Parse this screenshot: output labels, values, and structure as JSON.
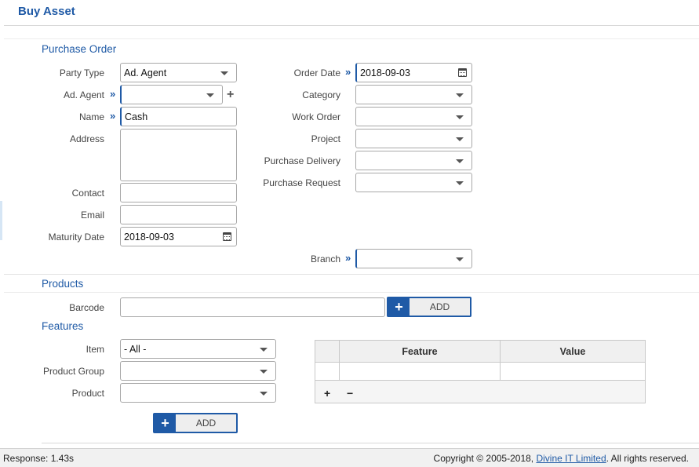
{
  "page": {
    "title": "Buy Asset"
  },
  "purchase_order": {
    "section_title": "Purchase Order",
    "party_type": {
      "label": "Party Type",
      "value": "Ad. Agent"
    },
    "ad_agent": {
      "label": "Ad. Agent",
      "value": ""
    },
    "name": {
      "label": "Name",
      "value": "Cash"
    },
    "address": {
      "label": "Address",
      "value": ""
    },
    "contact": {
      "label": "Contact",
      "value": ""
    },
    "email": {
      "label": "Email",
      "value": ""
    },
    "maturity_date": {
      "label": "Maturity Date",
      "value": "2018-09-03"
    },
    "order_date": {
      "label": "Order Date",
      "value": "2018-09-03"
    },
    "category": {
      "label": "Category",
      "value": ""
    },
    "work_order": {
      "label": "Work Order",
      "value": ""
    },
    "project": {
      "label": "Project",
      "value": ""
    },
    "purchase_delivery": {
      "label": "Purchase Delivery",
      "value": ""
    },
    "purchase_request": {
      "label": "Purchase Request",
      "value": ""
    },
    "branch": {
      "label": "Branch",
      "value": ""
    }
  },
  "products": {
    "section_title": "Products",
    "barcode": {
      "label": "Barcode",
      "value": ""
    },
    "add_label": "ADD"
  },
  "features": {
    "section_title": "Features",
    "item": {
      "label": "Item",
      "value": "- All -"
    },
    "product_group": {
      "label": "Product Group",
      "value": ""
    },
    "product": {
      "label": "Product",
      "value": ""
    },
    "add_label": "ADD",
    "table": {
      "columns": [
        "Feature",
        "Value"
      ]
    },
    "add_row_symbol": "+",
    "remove_row_symbol": "−"
  },
  "footer": {
    "response": "Response: 1.43s",
    "copyright_prefix": "Copyright © 2005-2018, ",
    "company_link": "Divine IT Limited",
    "copyright_suffix": ". All rights reserved."
  },
  "colors": {
    "accent": "#1f5aa6",
    "border": "#a8a8a8",
    "footer_bg": "#f1f1f1"
  },
  "icons": {
    "dropdown": "chevron-down-icon",
    "calendar": "calendar-icon",
    "lookup": "double-chevron-icon",
    "add": "plus-icon"
  }
}
